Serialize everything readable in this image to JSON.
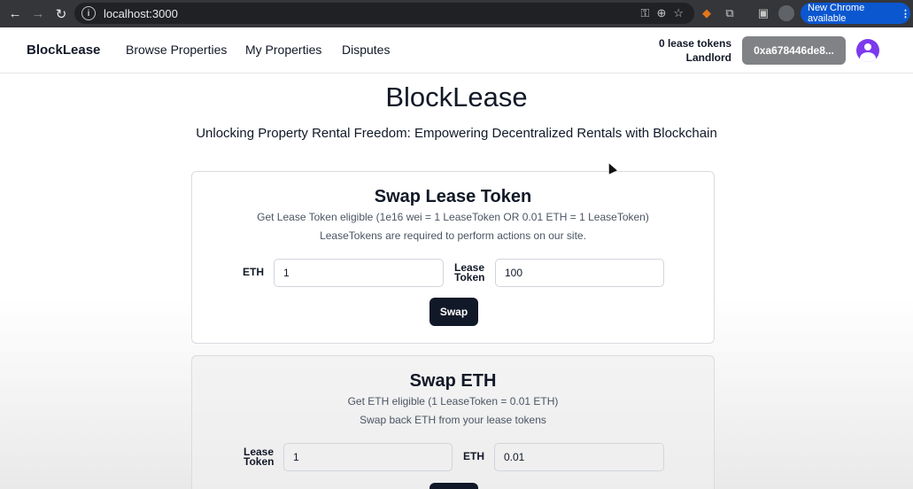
{
  "browser": {
    "url": "localhost:3000",
    "update_label": "New Chrome available",
    "update_menu": "⋮"
  },
  "header": {
    "brand": "BlockLease",
    "nav": [
      "Browse Properties",
      "My Properties",
      "Disputes"
    ],
    "balance": "0 lease tokens",
    "role": "Landlord",
    "wallet_address": "0xa678446de8..."
  },
  "hero": {
    "title": "BlockLease",
    "subtitle": "Unlocking Property Rental Freedom: Empowering Decentralized Rentals with Blockchain"
  },
  "swap_lease": {
    "title": "Swap Lease Token",
    "rate": "Get Lease Token eligible (1e16 wei = 1 LeaseToken OR 0.01 ETH = 1 LeaseToken)",
    "note": "LeaseTokens are required to perform actions on our site.",
    "eth_label": "ETH",
    "eth_value": "1",
    "token_label_1": "Lease",
    "token_label_2": "Token",
    "token_value": "100",
    "button": "Swap"
  },
  "swap_eth": {
    "title": "Swap ETH",
    "rate": "Get ETH eligible (1 LeaseToken = 0.01 ETH)",
    "note": "Swap back ETH from your lease tokens",
    "token_label_1": "Lease",
    "token_label_2": "Token",
    "token_value": "1",
    "eth_label": "ETH",
    "eth_value": "0.01"
  }
}
